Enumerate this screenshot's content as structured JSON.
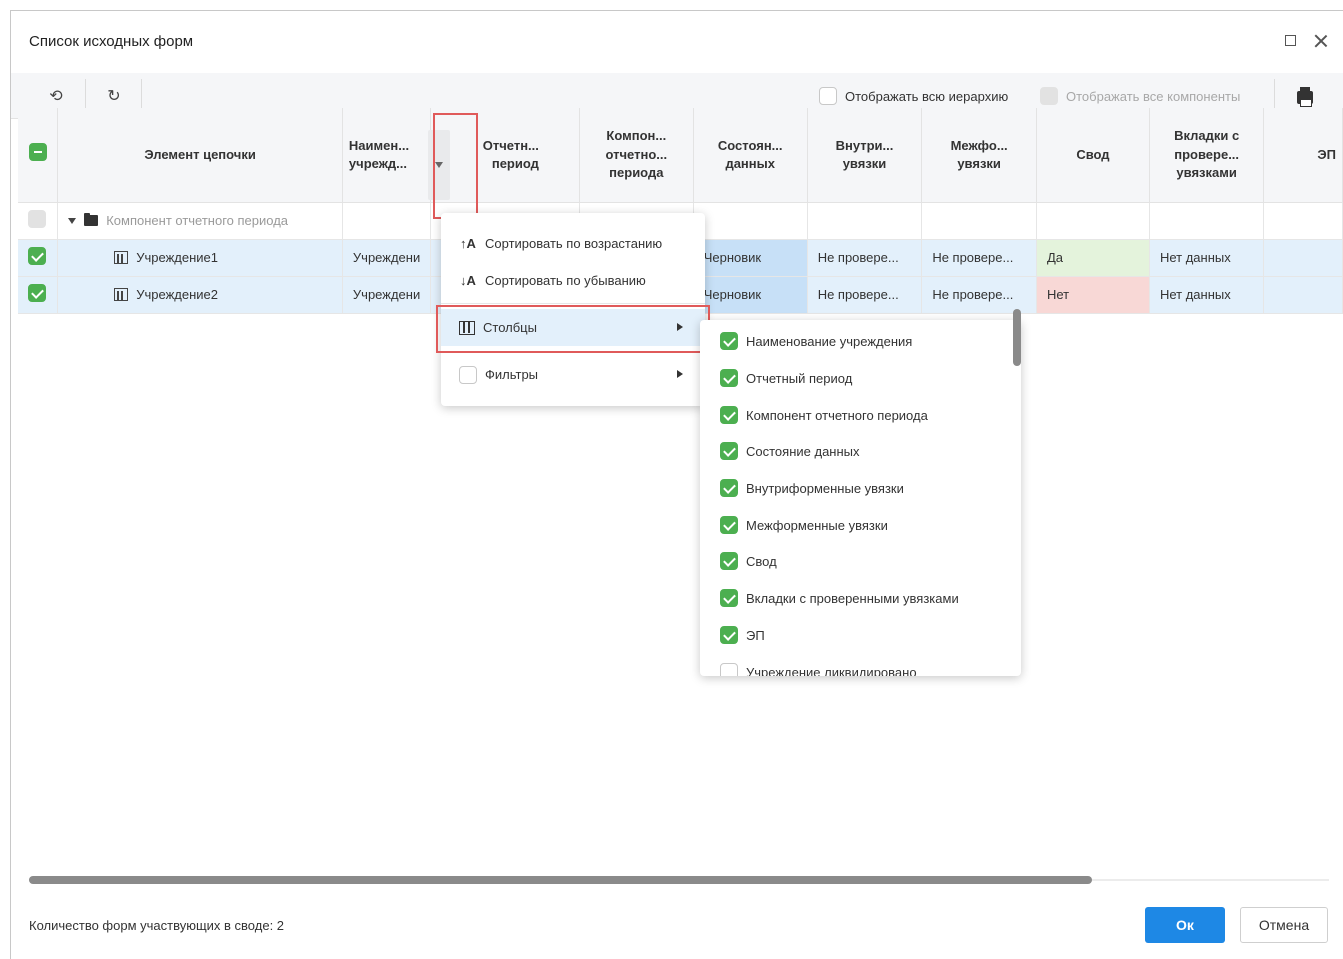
{
  "dialog": {
    "title": "Список исходных форм"
  },
  "toolbar": {
    "show_hierarchy_label": "Отображать всю иерархию",
    "show_components_label": "Отображать все компоненты"
  },
  "grid": {
    "headers": {
      "chain": "Элемент цепочки",
      "name": "Наимен... учрежд...",
      "period": "Отчетн... период",
      "component": "Компон... отчетно... периода",
      "state": "Состоян... данных",
      "internal": "Внутри... увязки",
      "inter": "Межфо... увязки",
      "summary": "Свод",
      "tabs": "Вкладки с провере... увязками",
      "ep": "ЭП"
    },
    "group_row": {
      "label": "Компонент отчетного периода"
    },
    "rows": [
      {
        "name": "Учреждение1",
        "org": "Учреждени",
        "state": "Черновик",
        "internal": "Не провере...",
        "inter": "Не провере...",
        "summary": "Да",
        "tabs": "Нет данных"
      },
      {
        "name": "Учреждение2",
        "org": "Учреждени",
        "state": "Черновик",
        "internal": "Не провере...",
        "inter": "Не провере...",
        "summary": "Нет",
        "tabs": "Нет данных"
      }
    ]
  },
  "context_menu": {
    "sort_asc": "Сортировать по возрастанию",
    "sort_desc": "Сортировать по убыванию",
    "columns": "Столбцы",
    "filters": "Фильтры"
  },
  "columns_submenu": {
    "items": [
      {
        "label": "Наименование учреждения",
        "checked": true
      },
      {
        "label": "Отчетный период",
        "checked": true
      },
      {
        "label": "Компонент отчетного периода",
        "checked": true
      },
      {
        "label": "Состояние данных",
        "checked": true
      },
      {
        "label": "Внутриформенные увязки",
        "checked": true
      },
      {
        "label": "Межформенные увязки",
        "checked": true
      },
      {
        "label": "Свод",
        "checked": true
      },
      {
        "label": "Вкладки с проверенными увязками",
        "checked": true
      },
      {
        "label": "ЭП",
        "checked": true
      },
      {
        "label": "Учреждение ликвидировано",
        "checked": false
      }
    ]
  },
  "footer": {
    "count_text": "Количество форм участвующих в своде: 2",
    "ok_label": "Ок",
    "cancel_label": "Отмена"
  },
  "colors": {
    "accent": "#1e88e5",
    "checkbox_green": "#4caf50",
    "highlight_red": "#e05a5a",
    "row_selected": "#e3f0fb",
    "status_blue": "#c7e0f7",
    "yes_green": "#e4f3dc",
    "no_red": "#f8d8d6"
  }
}
